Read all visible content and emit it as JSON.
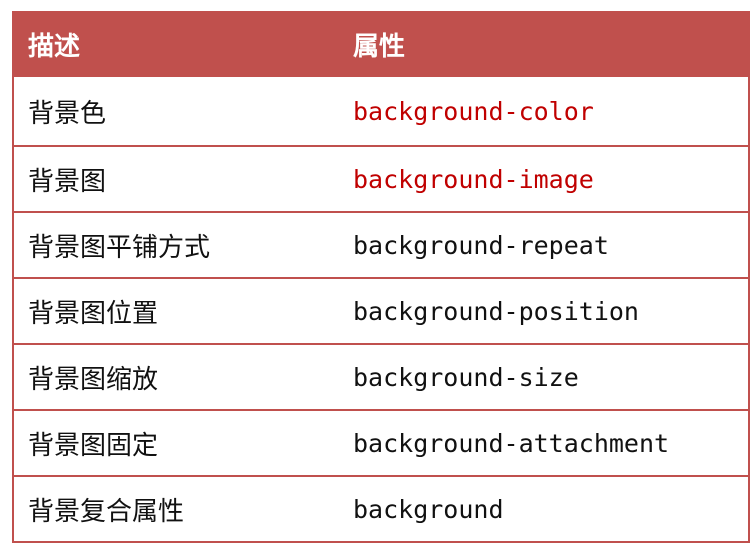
{
  "table": {
    "header": {
      "desc": "描述",
      "prop": "属性"
    },
    "rows": [
      {
        "desc": "背景色",
        "prop": "background-color",
        "highlight": true
      },
      {
        "desc": "背景图",
        "prop": "background-image",
        "highlight": true
      },
      {
        "desc": "背景图平铺方式",
        "prop": "background-repeat",
        "highlight": false
      },
      {
        "desc": "背景图位置",
        "prop": "background-position",
        "highlight": false
      },
      {
        "desc": "背景图缩放",
        "prop": "background-size",
        "highlight": false
      },
      {
        "desc": "背景图固定",
        "prop": "background-attachment",
        "highlight": false
      },
      {
        "desc": "背景复合属性",
        "prop": "background",
        "highlight": false
      }
    ]
  },
  "colors": {
    "header_bg": "#c0504d",
    "header_text": "#ffffff",
    "highlight_text": "#c00000",
    "border": "#c0504d"
  }
}
